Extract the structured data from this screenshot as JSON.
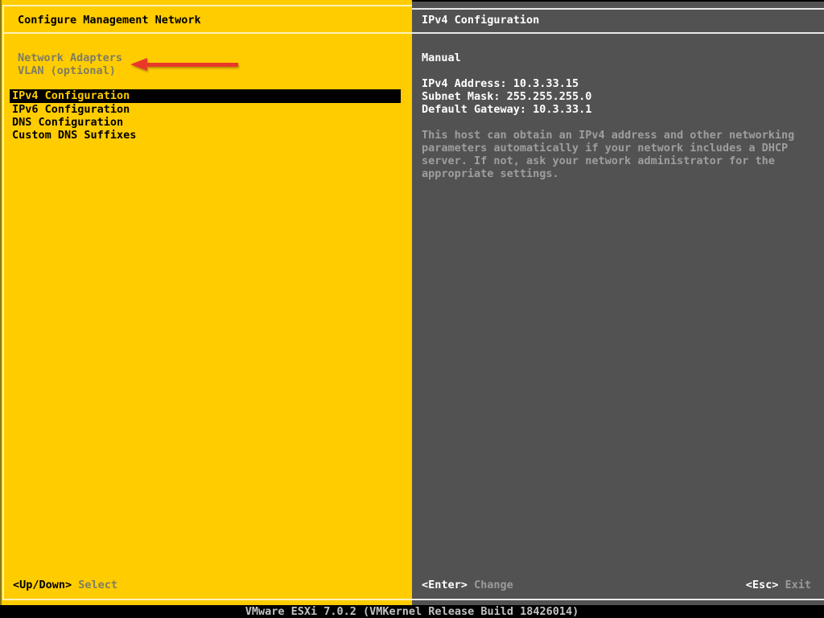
{
  "colors": {
    "accent_yellow": "#FFCC00",
    "panel_gray": "#525252",
    "arrow_red": "#E8392B"
  },
  "left_panel": {
    "title": "Configure Management Network",
    "info_items": [
      {
        "label": "Network Adapters"
      },
      {
        "label": "VLAN (optional)"
      }
    ],
    "menu_items": [
      {
        "label": "IPv4 Configuration",
        "state": "selected"
      },
      {
        "label": "IPv6 Configuration",
        "state": "normal"
      },
      {
        "label": "DNS Configuration",
        "state": "normal"
      },
      {
        "label": "Custom DNS Suffixes",
        "state": "normal"
      }
    ],
    "hint": {
      "key": "<Up/Down>",
      "label": "Select"
    },
    "annotation": {
      "icon": "red-arrow-left",
      "points_at": "Network Adapters / VLAN (optional)"
    }
  },
  "right_panel": {
    "title": "IPv4 Configuration",
    "mode": "Manual",
    "fields": [
      {
        "label": "IPv4 Address: ",
        "value": "10.3.33.15"
      },
      {
        "label": "Subnet Mask: ",
        "value": "255.255.255.0"
      },
      {
        "label": "Default Gateway: ",
        "value": "10.3.33.1"
      }
    ],
    "description_lines": [
      "This host can obtain an IPv4 address and other networking",
      "parameters automatically if your network includes a DHCP",
      "server. If not, ask your network administrator for the",
      "appropriate settings."
    ],
    "hints": [
      {
        "key": "<Enter>",
        "label": "Change"
      },
      {
        "key": "<Esc>",
        "label": "Exit"
      }
    ]
  },
  "status_bar": {
    "text": "VMware ESXi 7.0.2 (VMKernel Release Build 18426014)"
  }
}
